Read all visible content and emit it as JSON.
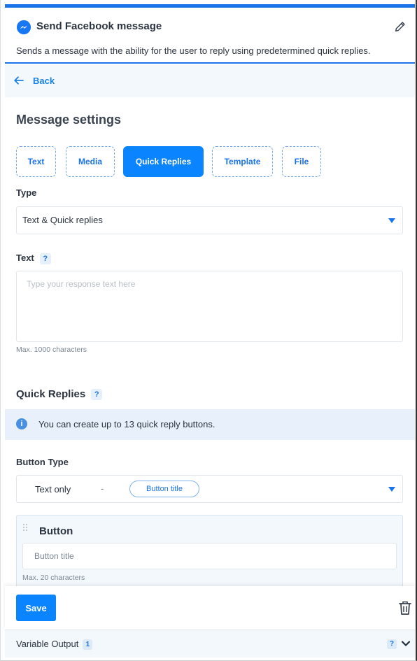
{
  "header": {
    "title": "Send Facebook message",
    "description": "Sends a message with the ability for the user to reply using predetermined quick replies."
  },
  "back": {
    "label": "Back"
  },
  "settings": {
    "title": "Message settings",
    "tabs": [
      {
        "label": "Text",
        "active": false
      },
      {
        "label": "Media",
        "active": false
      },
      {
        "label": "Quick Replies",
        "active": true
      },
      {
        "label": "Template",
        "active": false
      },
      {
        "label": "File",
        "active": false
      }
    ]
  },
  "type_field": {
    "label": "Type",
    "value": "Text & Quick replies"
  },
  "text_field": {
    "label": "Text",
    "help": "?",
    "placeholder": "Type your response text here",
    "value": "",
    "hint": "Max. 1000 characters"
  },
  "quick_replies": {
    "title": "Quick Replies",
    "help": "?",
    "info_icon": "i",
    "info": "You can create up to 13 quick reply buttons."
  },
  "button_type": {
    "label": "Button Type",
    "value": "Text only",
    "separator": "-",
    "preview_pill": "Button title"
  },
  "button_card": {
    "title": "Button",
    "input_placeholder": "Button title",
    "input_value": "",
    "hint": "Max. 20 characters"
  },
  "footer": {
    "save_label": "Save"
  },
  "variable_output": {
    "label": "Variable Output",
    "count": "1",
    "help": "?"
  },
  "colors": {
    "accent": "#0a84ff",
    "link": "#1a73e8",
    "panel": "#f3f8fc",
    "info_bg": "#e8f1fb"
  },
  "icons": {
    "header": "messenger-icon",
    "edit": "pencil-icon",
    "back": "arrow-left-icon",
    "info": "info-icon",
    "drag": "drag-handle-icon",
    "delete": "trash-icon",
    "expand": "chevron-down-icon"
  }
}
